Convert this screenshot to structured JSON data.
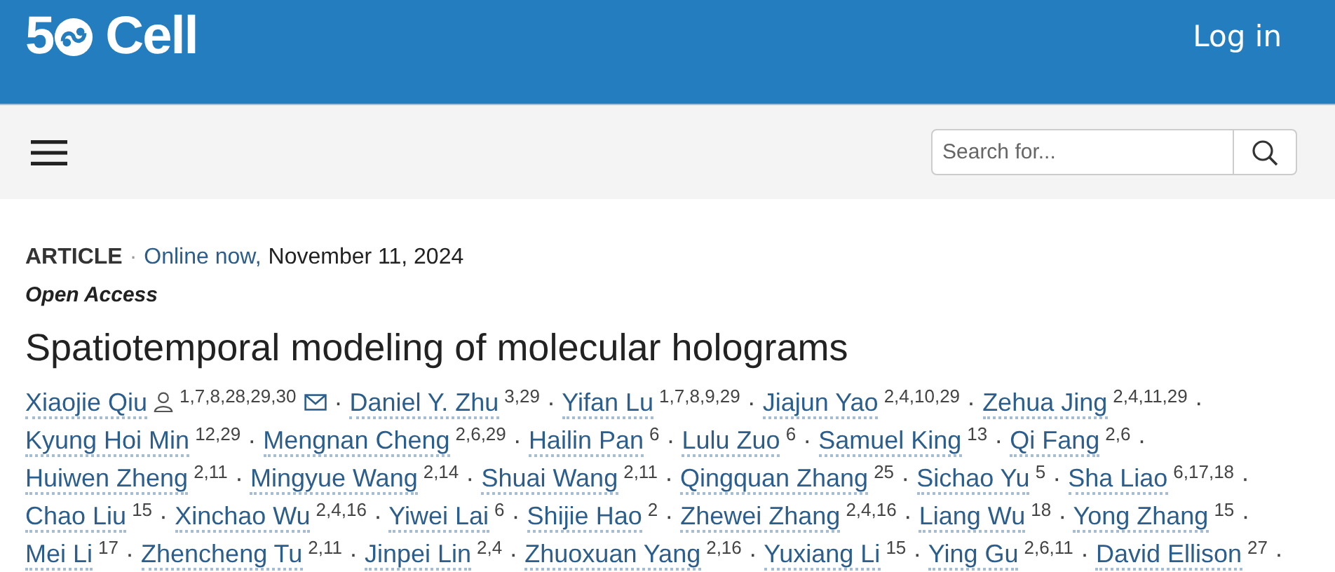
{
  "header": {
    "logo_number": "5",
    "logo_name": "Cell",
    "login": "Log in"
  },
  "search": {
    "placeholder": "Search for..."
  },
  "article": {
    "type": "ARTICLE",
    "separator": "·",
    "status": "Online now,",
    "date": "November 11, 2024",
    "access": "Open Access",
    "title": "Spatiotemporal modeling of molecular holograms"
  },
  "authors": [
    {
      "name": "Xiaojie Qiu",
      "aff": "1,7,8,28,29,30",
      "corresponding": true,
      "sep": "·"
    },
    {
      "name": "Daniel Y. Zhu",
      "aff": "3,29",
      "corresponding": false,
      "sep": "·"
    },
    {
      "name": "Yifan Lu",
      "aff": "1,7,8,9,29",
      "corresponding": false,
      "sep": "·"
    },
    {
      "name": "Jiajun Yao",
      "aff": "2,4,10,29",
      "corresponding": false,
      "sep": "·"
    },
    {
      "name": "Zehua Jing",
      "aff": "2,4,11,29",
      "corresponding": false,
      "sep": "·"
    },
    {
      "name": "Kyung Hoi Min",
      "aff": "12,29",
      "corresponding": false,
      "sep": "·"
    },
    {
      "name": "Mengnan Cheng",
      "aff": "2,6,29",
      "corresponding": false,
      "sep": "·"
    },
    {
      "name": "Hailin Pan",
      "aff": "6",
      "corresponding": false,
      "sep": "·"
    },
    {
      "name": "Lulu Zuo",
      "aff": "6",
      "corresponding": false,
      "sep": "·"
    },
    {
      "name": "Samuel King",
      "aff": "13",
      "corresponding": false,
      "sep": "·"
    },
    {
      "name": "Qi Fang",
      "aff": "2,6",
      "corresponding": false,
      "sep": "·"
    },
    {
      "name": "Huiwen Zheng",
      "aff": "2,11",
      "corresponding": false,
      "sep": "·"
    },
    {
      "name": "Mingyue Wang",
      "aff": "2,14",
      "corresponding": false,
      "sep": "·"
    },
    {
      "name": "Shuai Wang",
      "aff": "2,11",
      "corresponding": false,
      "sep": "·"
    },
    {
      "name": "Qingquan Zhang",
      "aff": "25",
      "corresponding": false,
      "sep": "·"
    },
    {
      "name": "Sichao Yu",
      "aff": "5",
      "corresponding": false,
      "sep": "·"
    },
    {
      "name": "Sha Liao",
      "aff": "6,17,18",
      "corresponding": false,
      "sep": "·"
    },
    {
      "name": "Chao Liu",
      "aff": "15",
      "corresponding": false,
      "sep": "·"
    },
    {
      "name": "Xinchao Wu",
      "aff": "2,4,16",
      "corresponding": false,
      "sep": "·"
    },
    {
      "name": "Yiwei Lai",
      "aff": "6",
      "corresponding": false,
      "sep": "·"
    },
    {
      "name": "Shijie Hao",
      "aff": "2",
      "corresponding": false,
      "sep": "·"
    },
    {
      "name": "Zhewei Zhang",
      "aff": "2,4,16",
      "corresponding": false,
      "sep": "·"
    },
    {
      "name": "Liang Wu",
      "aff": "18",
      "corresponding": false,
      "sep": "·"
    },
    {
      "name": "Yong Zhang",
      "aff": "15",
      "corresponding": false,
      "sep": "·"
    },
    {
      "name": "Mei Li",
      "aff": "17",
      "corresponding": false,
      "sep": "·"
    },
    {
      "name": "Zhencheng Tu",
      "aff": "2,11",
      "corresponding": false,
      "sep": "·"
    },
    {
      "name": "Jinpei Lin",
      "aff": "2,4",
      "corresponding": false,
      "sep": "·"
    },
    {
      "name": "Zhuoxuan Yang",
      "aff": "2,16",
      "corresponding": false,
      "sep": "·"
    },
    {
      "name": "Yuxiang Li",
      "aff": "15",
      "corresponding": false,
      "sep": "·"
    },
    {
      "name": "Ying Gu",
      "aff": "2,6,11",
      "corresponding": false,
      "sep": "·"
    },
    {
      "name": "David Ellison",
      "aff": "27",
      "corresponding": false,
      "sep": "·"
    }
  ]
}
